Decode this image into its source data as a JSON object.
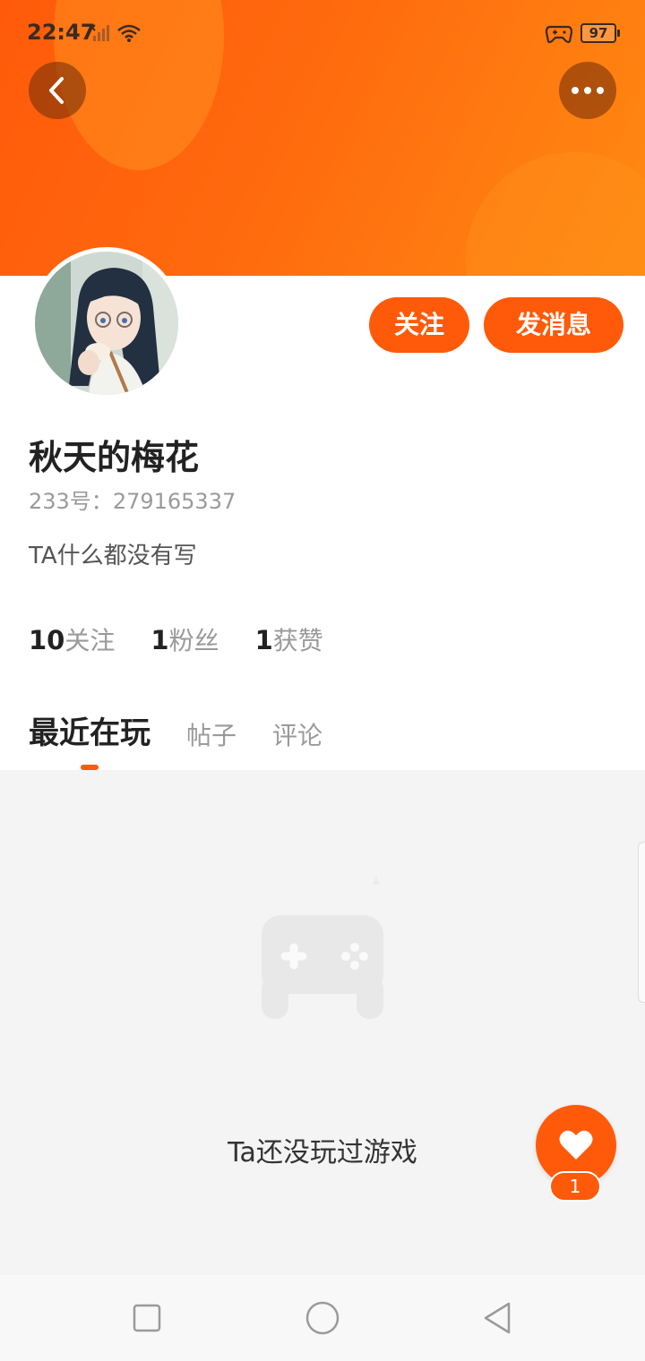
{
  "status_bar": {
    "time": "22:47",
    "battery": "97"
  },
  "icons": {
    "back": "chevron-left-icon",
    "more": "more-dots-icon",
    "like": "heart-icon",
    "empty_state": "gamepad-icon"
  },
  "colors": {
    "accent": "#ff5a0a",
    "banner_end": "#ff8a12",
    "content_bg": "#f4f4f4"
  },
  "profile": {
    "username": "秋天的梅花",
    "uid_label": "233号：",
    "uid_value": "279165337",
    "bio": "TA什么都没有写"
  },
  "actions": {
    "follow": "关注",
    "message": "发消息"
  },
  "stats": [
    {
      "value": "10",
      "label": "关注"
    },
    {
      "value": "1",
      "label": "粉丝"
    },
    {
      "value": "1",
      "label": "获赞"
    }
  ],
  "tabs": [
    {
      "label": "最近在玩",
      "active": true
    },
    {
      "label": "帖子",
      "active": false
    },
    {
      "label": "评论",
      "active": false
    }
  ],
  "empty_state": {
    "text": "Ta还没玩过游戏"
  },
  "like_badge": {
    "count": "1"
  }
}
